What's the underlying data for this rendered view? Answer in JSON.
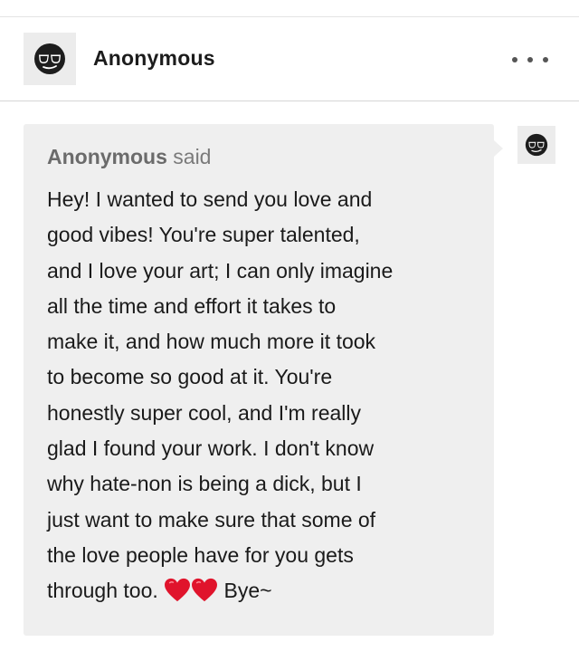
{
  "post_header": {
    "avatar_icon": "sunglasses-face-icon",
    "name": "Anonymous",
    "more_icon": "ellipsis-icon"
  },
  "ask": {
    "asker_name": "Anonymous",
    "said": "said",
    "avatar_icon": "sunglasses-face-icon",
    "lines": [
      "Hey! I wanted to send you love and",
      "good vibes! You're super talented,",
      "and I love your art; I can only imagine",
      "all the time and effort it takes to",
      "make it, and how much more it took",
      "to become so good at it. You're",
      "honestly super cool, and I'm really",
      "glad I found your work. I don't know",
      "why hate-non is being a dick, but I",
      "just want to make sure that some of",
      "the love people have for you gets"
    ],
    "last_line_start": "through too.",
    "heart_icon": "red-heart-icon",
    "last_line_end": "Bye~"
  },
  "colors": {
    "bubble_background": "#efefef",
    "heart": "#e0142c"
  }
}
